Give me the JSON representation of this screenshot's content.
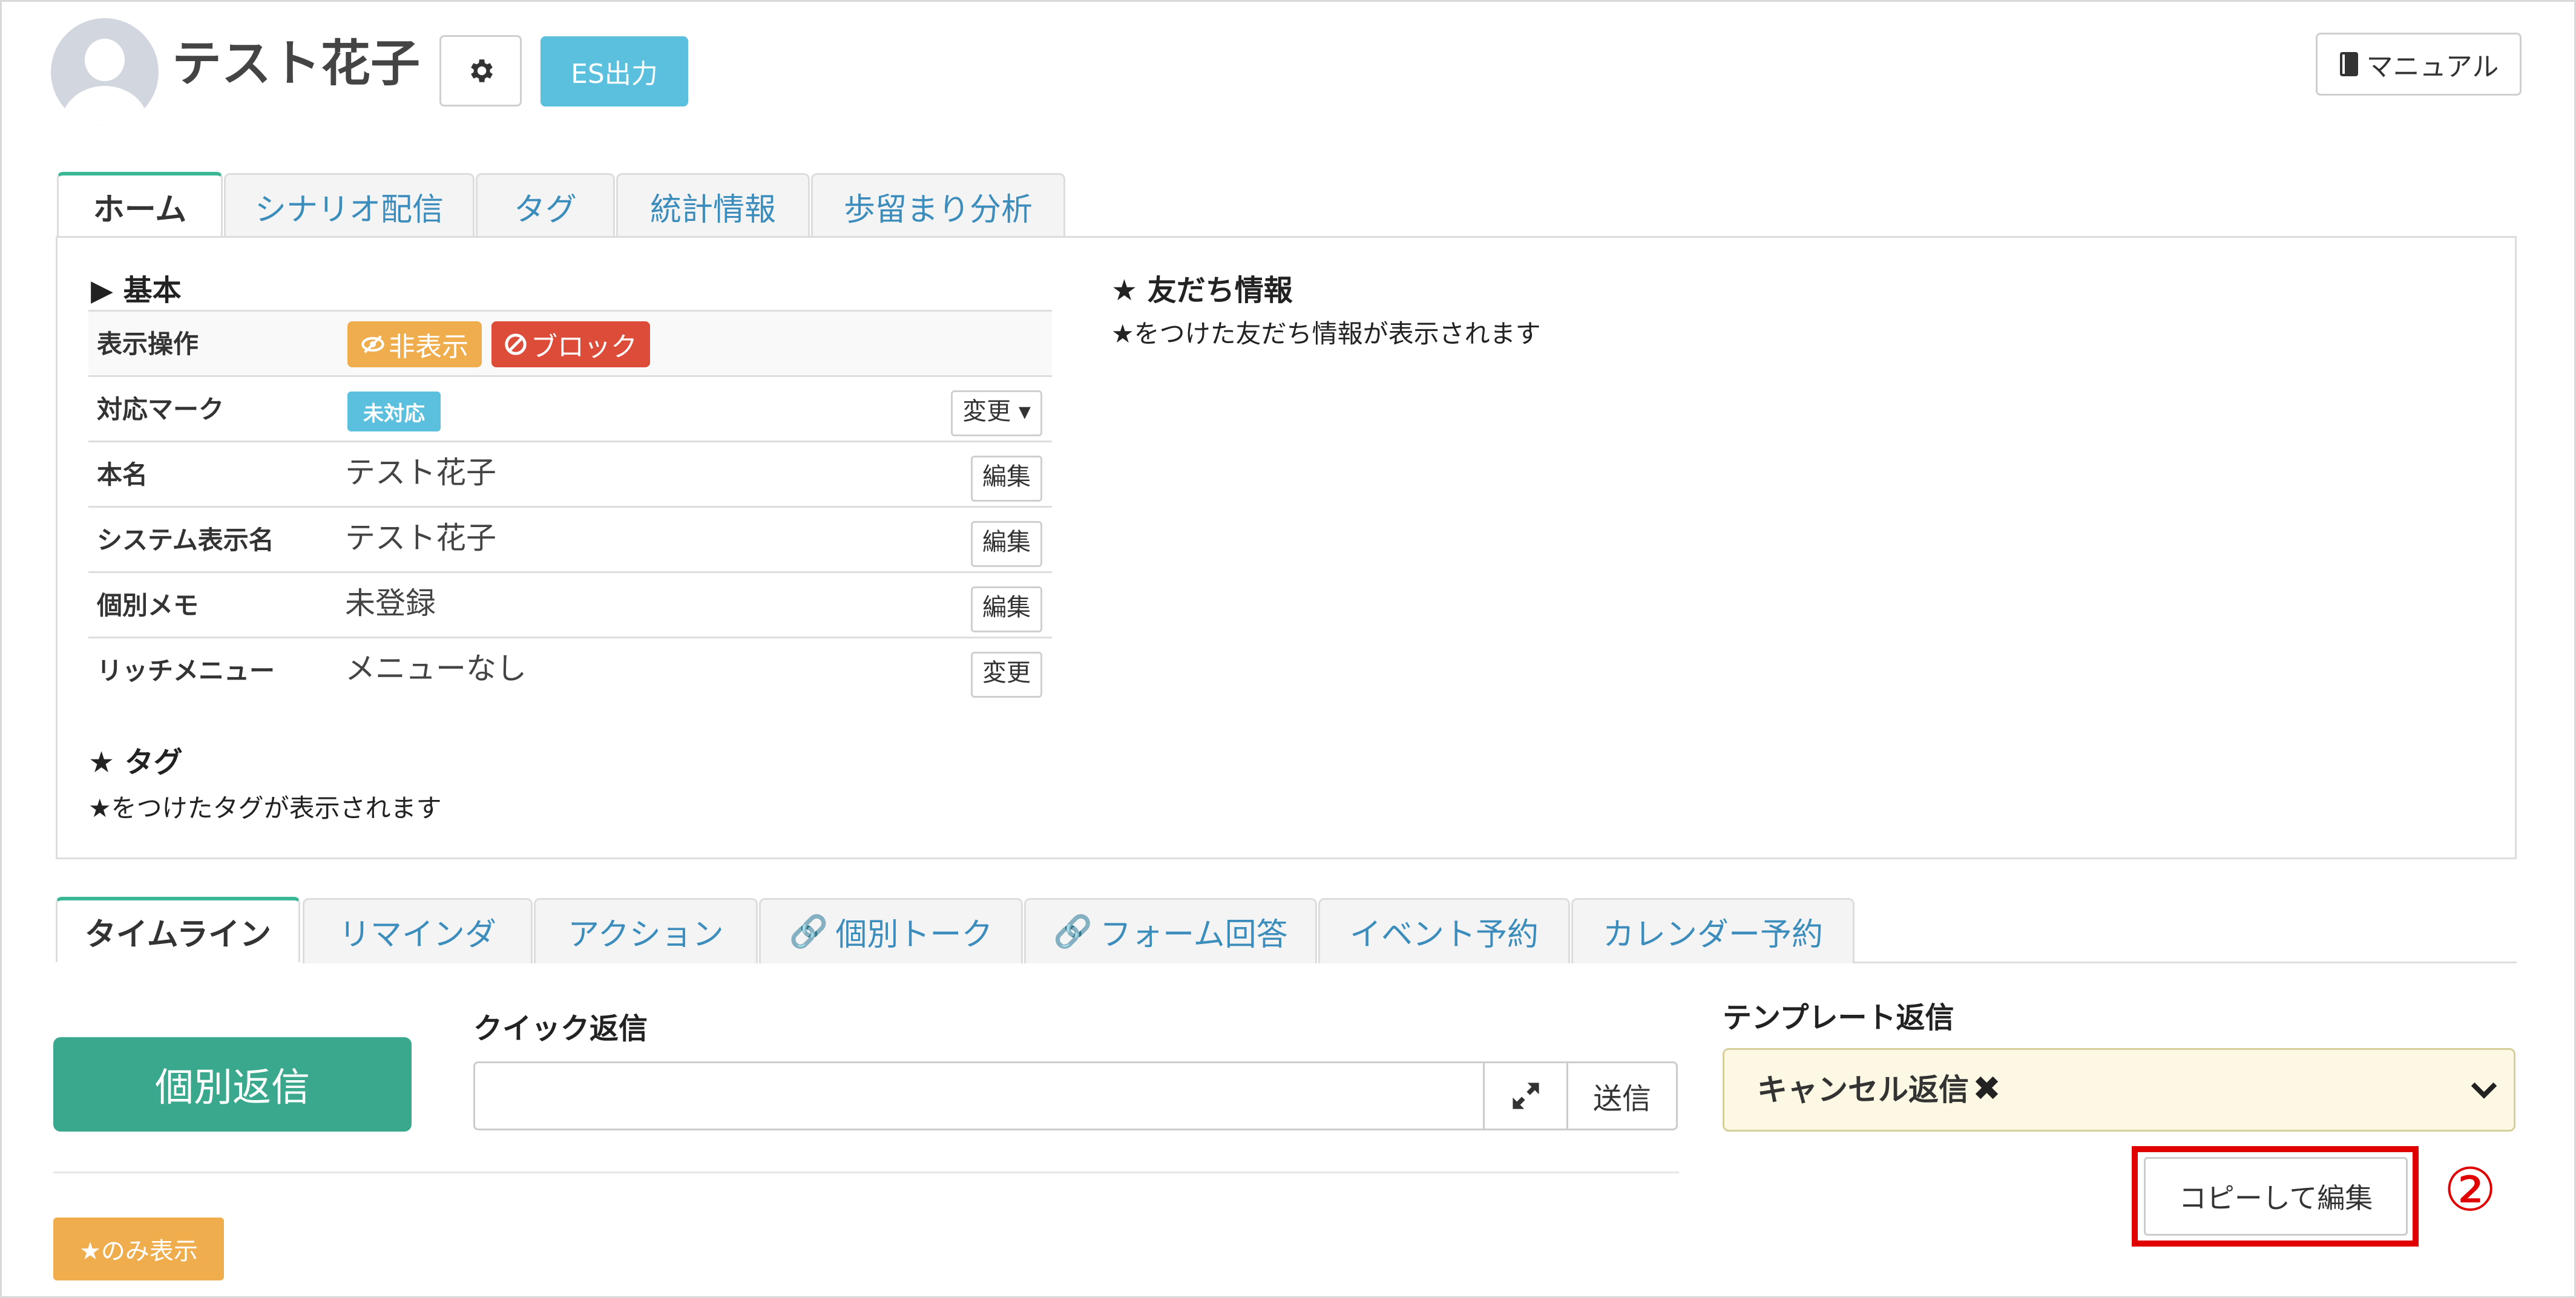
{
  "header": {
    "title": "テスト花子",
    "settings_icon": "gear-icon",
    "es_button": "ES出力",
    "manual_button": "マニュアル",
    "manual_icon": "book-icon"
  },
  "top_tabs": [
    "ホーム",
    "シナリオ配信",
    "タグ",
    "統計情報",
    "歩留まり分析"
  ],
  "basic": {
    "heading": "▶ 基本",
    "rows": [
      {
        "label": "表示操作"
      },
      {
        "label": "対応マーク",
        "button": "変更 ▾"
      },
      {
        "label": "本名",
        "value": "テスト花子",
        "button": "編集"
      },
      {
        "label": "システム表示名",
        "value": "テスト花子",
        "button": "編集"
      },
      {
        "label": "個別メモ",
        "value": "未登録",
        "button": "編集"
      },
      {
        "label": "リッチメニュー",
        "value": "メニューなし",
        "button": "変更"
      }
    ],
    "hide_badge": "非表示",
    "block_badge": "ブロック",
    "mark_badge": "未対応"
  },
  "tags": {
    "heading": "★ タグ",
    "sub": "★をつけたタグが表示されます"
  },
  "friend_info": {
    "heading": "★ 友だち情報",
    "sub": "★をつけた友だち情報が表示されます"
  },
  "bottom_tabs": [
    "タイムライン",
    "リマインダ",
    "アクション",
    "個別トーク",
    "フォーム回答",
    "イベント予約",
    "カレンダー予約"
  ],
  "reply": {
    "individual_button": "個別返信",
    "quick_label": "クイック返信",
    "quick_value": "",
    "send_button": "送信",
    "template_label": "テンプレート返信",
    "template_value": "キャンセル返信",
    "copy_button": "コピーして編集",
    "step_marker": "②",
    "star_only_button": "★のみ表示"
  },
  "colors": {
    "accent": "#3aa88c",
    "info": "#5bc0de",
    "warning": "#f0ad4e",
    "danger": "#dd4b39",
    "highlight": "#e00000"
  }
}
